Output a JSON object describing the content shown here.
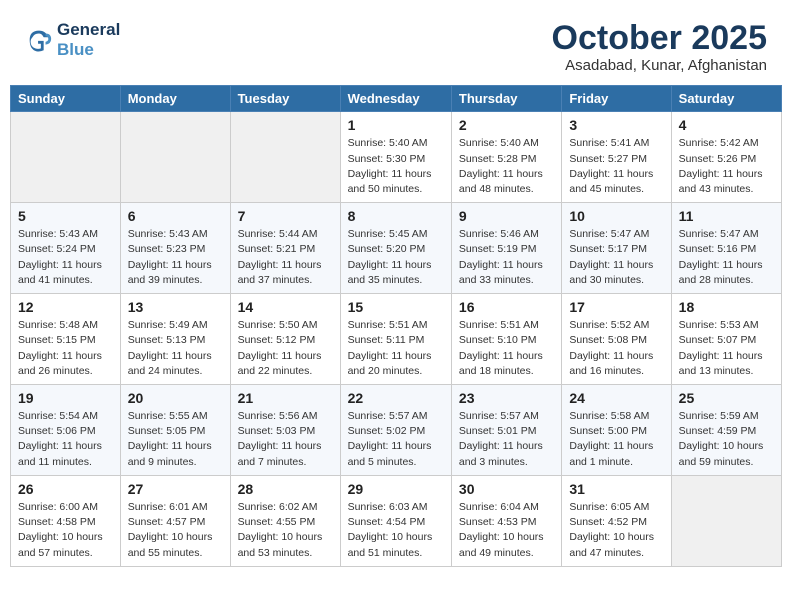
{
  "header": {
    "logo_line1": "General",
    "logo_line2": "Blue",
    "month": "October 2025",
    "location": "Asadabad, Kunar, Afghanistan"
  },
  "weekdays": [
    "Sunday",
    "Monday",
    "Tuesday",
    "Wednesday",
    "Thursday",
    "Friday",
    "Saturday"
  ],
  "weeks": [
    [
      {
        "day": "",
        "sunrise": "",
        "sunset": "",
        "daylight": ""
      },
      {
        "day": "",
        "sunrise": "",
        "sunset": "",
        "daylight": ""
      },
      {
        "day": "",
        "sunrise": "",
        "sunset": "",
        "daylight": ""
      },
      {
        "day": "1",
        "sunrise": "Sunrise: 5:40 AM",
        "sunset": "Sunset: 5:30 PM",
        "daylight": "Daylight: 11 hours and 50 minutes."
      },
      {
        "day": "2",
        "sunrise": "Sunrise: 5:40 AM",
        "sunset": "Sunset: 5:28 PM",
        "daylight": "Daylight: 11 hours and 48 minutes."
      },
      {
        "day": "3",
        "sunrise": "Sunrise: 5:41 AM",
        "sunset": "Sunset: 5:27 PM",
        "daylight": "Daylight: 11 hours and 45 minutes."
      },
      {
        "day": "4",
        "sunrise": "Sunrise: 5:42 AM",
        "sunset": "Sunset: 5:26 PM",
        "daylight": "Daylight: 11 hours and 43 minutes."
      }
    ],
    [
      {
        "day": "5",
        "sunrise": "Sunrise: 5:43 AM",
        "sunset": "Sunset: 5:24 PM",
        "daylight": "Daylight: 11 hours and 41 minutes."
      },
      {
        "day": "6",
        "sunrise": "Sunrise: 5:43 AM",
        "sunset": "Sunset: 5:23 PM",
        "daylight": "Daylight: 11 hours and 39 minutes."
      },
      {
        "day": "7",
        "sunrise": "Sunrise: 5:44 AM",
        "sunset": "Sunset: 5:21 PM",
        "daylight": "Daylight: 11 hours and 37 minutes."
      },
      {
        "day": "8",
        "sunrise": "Sunrise: 5:45 AM",
        "sunset": "Sunset: 5:20 PM",
        "daylight": "Daylight: 11 hours and 35 minutes."
      },
      {
        "day": "9",
        "sunrise": "Sunrise: 5:46 AM",
        "sunset": "Sunset: 5:19 PM",
        "daylight": "Daylight: 11 hours and 33 minutes."
      },
      {
        "day": "10",
        "sunrise": "Sunrise: 5:47 AM",
        "sunset": "Sunset: 5:17 PM",
        "daylight": "Daylight: 11 hours and 30 minutes."
      },
      {
        "day": "11",
        "sunrise": "Sunrise: 5:47 AM",
        "sunset": "Sunset: 5:16 PM",
        "daylight": "Daylight: 11 hours and 28 minutes."
      }
    ],
    [
      {
        "day": "12",
        "sunrise": "Sunrise: 5:48 AM",
        "sunset": "Sunset: 5:15 PM",
        "daylight": "Daylight: 11 hours and 26 minutes."
      },
      {
        "day": "13",
        "sunrise": "Sunrise: 5:49 AM",
        "sunset": "Sunset: 5:13 PM",
        "daylight": "Daylight: 11 hours and 24 minutes."
      },
      {
        "day": "14",
        "sunrise": "Sunrise: 5:50 AM",
        "sunset": "Sunset: 5:12 PM",
        "daylight": "Daylight: 11 hours and 22 minutes."
      },
      {
        "day": "15",
        "sunrise": "Sunrise: 5:51 AM",
        "sunset": "Sunset: 5:11 PM",
        "daylight": "Daylight: 11 hours and 20 minutes."
      },
      {
        "day": "16",
        "sunrise": "Sunrise: 5:51 AM",
        "sunset": "Sunset: 5:10 PM",
        "daylight": "Daylight: 11 hours and 18 minutes."
      },
      {
        "day": "17",
        "sunrise": "Sunrise: 5:52 AM",
        "sunset": "Sunset: 5:08 PM",
        "daylight": "Daylight: 11 hours and 16 minutes."
      },
      {
        "day": "18",
        "sunrise": "Sunrise: 5:53 AM",
        "sunset": "Sunset: 5:07 PM",
        "daylight": "Daylight: 11 hours and 13 minutes."
      }
    ],
    [
      {
        "day": "19",
        "sunrise": "Sunrise: 5:54 AM",
        "sunset": "Sunset: 5:06 PM",
        "daylight": "Daylight: 11 hours and 11 minutes."
      },
      {
        "day": "20",
        "sunrise": "Sunrise: 5:55 AM",
        "sunset": "Sunset: 5:05 PM",
        "daylight": "Daylight: 11 hours and 9 minutes."
      },
      {
        "day": "21",
        "sunrise": "Sunrise: 5:56 AM",
        "sunset": "Sunset: 5:03 PM",
        "daylight": "Daylight: 11 hours and 7 minutes."
      },
      {
        "day": "22",
        "sunrise": "Sunrise: 5:57 AM",
        "sunset": "Sunset: 5:02 PM",
        "daylight": "Daylight: 11 hours and 5 minutes."
      },
      {
        "day": "23",
        "sunrise": "Sunrise: 5:57 AM",
        "sunset": "Sunset: 5:01 PM",
        "daylight": "Daylight: 11 hours and 3 minutes."
      },
      {
        "day": "24",
        "sunrise": "Sunrise: 5:58 AM",
        "sunset": "Sunset: 5:00 PM",
        "daylight": "Daylight: 11 hours and 1 minute."
      },
      {
        "day": "25",
        "sunrise": "Sunrise: 5:59 AM",
        "sunset": "Sunset: 4:59 PM",
        "daylight": "Daylight: 10 hours and 59 minutes."
      }
    ],
    [
      {
        "day": "26",
        "sunrise": "Sunrise: 6:00 AM",
        "sunset": "Sunset: 4:58 PM",
        "daylight": "Daylight: 10 hours and 57 minutes."
      },
      {
        "day": "27",
        "sunrise": "Sunrise: 6:01 AM",
        "sunset": "Sunset: 4:57 PM",
        "daylight": "Daylight: 10 hours and 55 minutes."
      },
      {
        "day": "28",
        "sunrise": "Sunrise: 6:02 AM",
        "sunset": "Sunset: 4:55 PM",
        "daylight": "Daylight: 10 hours and 53 minutes."
      },
      {
        "day": "29",
        "sunrise": "Sunrise: 6:03 AM",
        "sunset": "Sunset: 4:54 PM",
        "daylight": "Daylight: 10 hours and 51 minutes."
      },
      {
        "day": "30",
        "sunrise": "Sunrise: 6:04 AM",
        "sunset": "Sunset: 4:53 PM",
        "daylight": "Daylight: 10 hours and 49 minutes."
      },
      {
        "day": "31",
        "sunrise": "Sunrise: 6:05 AM",
        "sunset": "Sunset: 4:52 PM",
        "daylight": "Daylight: 10 hours and 47 minutes."
      },
      {
        "day": "",
        "sunrise": "",
        "sunset": "",
        "daylight": ""
      }
    ]
  ]
}
